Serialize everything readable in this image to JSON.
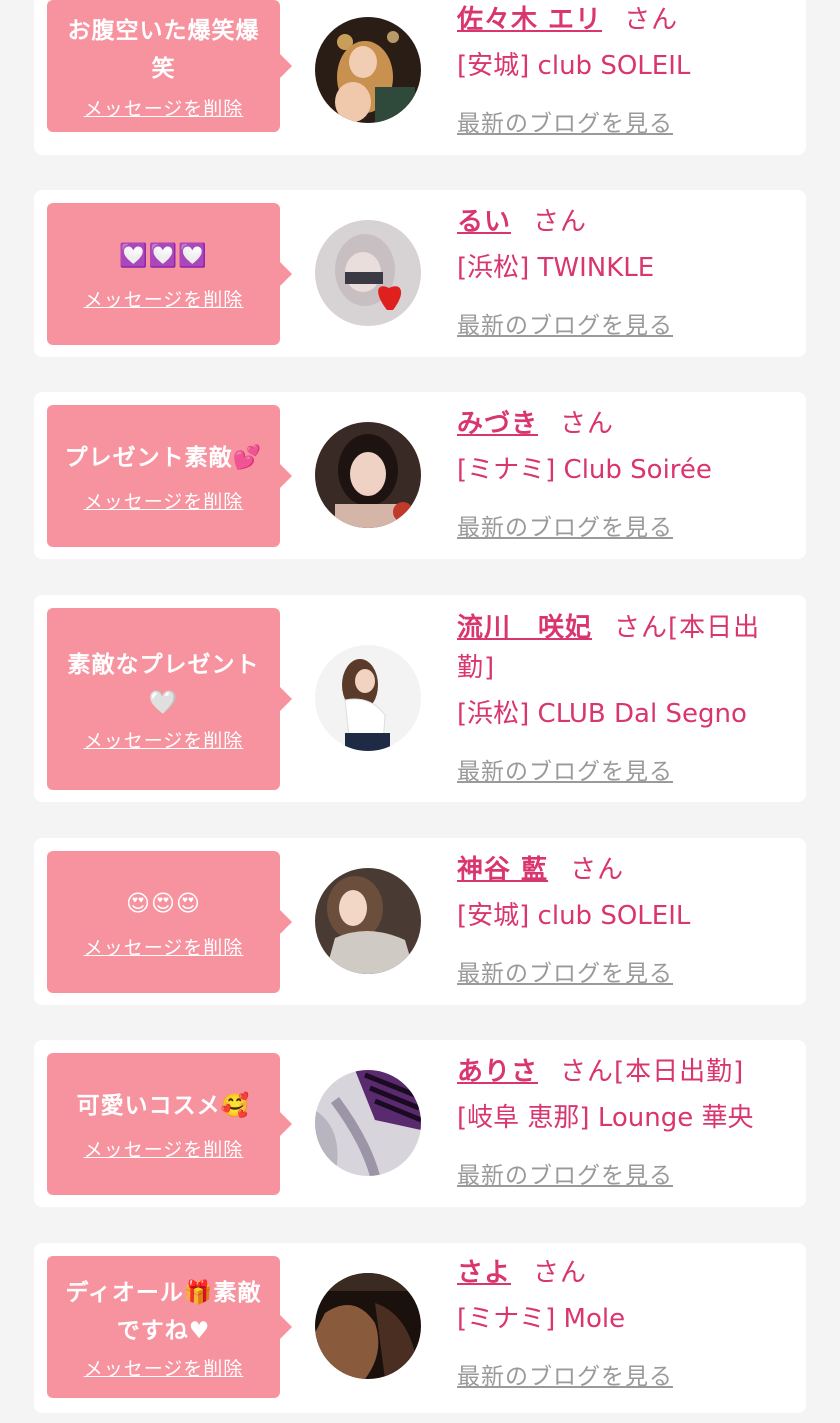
{
  "colors": {
    "accent": "#d9356f",
    "bubble": "#f7929f",
    "muted": "#9a9a9a",
    "background": "#f4f4f4"
  },
  "cards": [
    {
      "message": "お腹空いた爆笑爆笑",
      "delete_label": "メッセージを削除",
      "name": "佐々木 エリ",
      "suffix": "さん",
      "shop": "[安城] club SOLEIL",
      "blog_label": "最新のブログを見る",
      "avatar_icon": "profile-photo"
    },
    {
      "message": "💟💟💟",
      "delete_label": "メッセージを削除",
      "name": "るい",
      "suffix": "さん",
      "shop": "[浜松] TWINKLE",
      "blog_label": "最新のブログを見る",
      "avatar_icon": "profile-photo"
    },
    {
      "message": "プレゼント素敵💕",
      "delete_label": "メッセージを削除",
      "name": "みづき",
      "suffix": "さん",
      "shop": "[ミナミ] Club Soirée",
      "blog_label": "最新のブログを見る",
      "avatar_icon": "profile-photo"
    },
    {
      "message": "素敵なプレゼント🤍",
      "delete_label": "メッセージを削除",
      "name": "流川　咲妃",
      "suffix": "さん[本日出勤]",
      "shop": "[浜松] CLUB Dal Segno",
      "blog_label": "最新のブログを見る",
      "avatar_icon": "profile-photo"
    },
    {
      "message": "😍😍😍",
      "delete_label": "メッセージを削除",
      "name": "神谷 藍",
      "suffix": "さん",
      "shop": "[安城] club SOLEIL",
      "blog_label": "最新のブログを見る",
      "avatar_icon": "profile-photo"
    },
    {
      "message": "可愛いコスメ🥰",
      "delete_label": "メッセージを削除",
      "name": "ありさ",
      "suffix": "さん[本日出勤]",
      "shop": "[岐阜 恵那] Lounge 華央",
      "blog_label": "最新のブログを見る",
      "avatar_icon": "profile-photo"
    },
    {
      "message": "ディオール🎁素敵ですね♥",
      "delete_label": "メッセージを削除",
      "name": "さよ",
      "suffix": "さん",
      "shop": "[ミナミ] Mole",
      "blog_label": "最新のブログを見る",
      "avatar_icon": "profile-photo"
    }
  ]
}
